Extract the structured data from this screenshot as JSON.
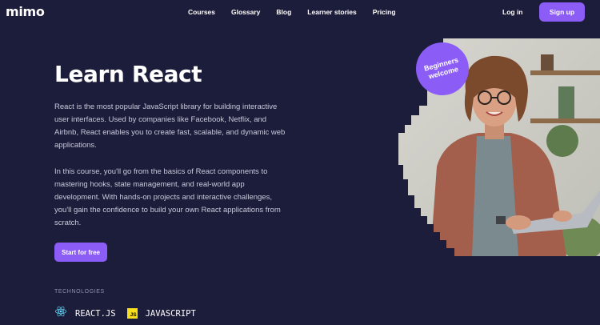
{
  "brand": {
    "logo_text": "mimo"
  },
  "nav": {
    "links": [
      "Courses",
      "Glossary",
      "Blog",
      "Learner stories",
      "Pricing"
    ],
    "login_label": "Log in",
    "signup_label": "Sign up"
  },
  "hero": {
    "title": "Learn React",
    "paragraph_1": "React is the most popular JavaScript library for building interactive user interfaces. Used by companies like Facebook, Netflix, and Airbnb, React enables you to create fast, scalable, and dynamic web applications.",
    "paragraph_2": "In this course, you'll go from the basics of React components to mastering hooks, state management, and real-world app development. With hands-on projects and interactive challenges, you'll gain the confidence to build your own React applications from scratch.",
    "cta_label": "Start for free",
    "badge_text": "Beginners welcome"
  },
  "technologies": {
    "label": "TECHNOLOGIES",
    "items": [
      {
        "name": "REACT.JS",
        "icon": "react-icon"
      },
      {
        "name": "JAVASCRIPT",
        "icon": "javascript-icon",
        "icon_text": "JS"
      }
    ]
  },
  "colors": {
    "background": "#1c1d3a",
    "accent": "#8b5cf6",
    "react_blue": "#61dafb",
    "js_yellow": "#f7df1e"
  }
}
